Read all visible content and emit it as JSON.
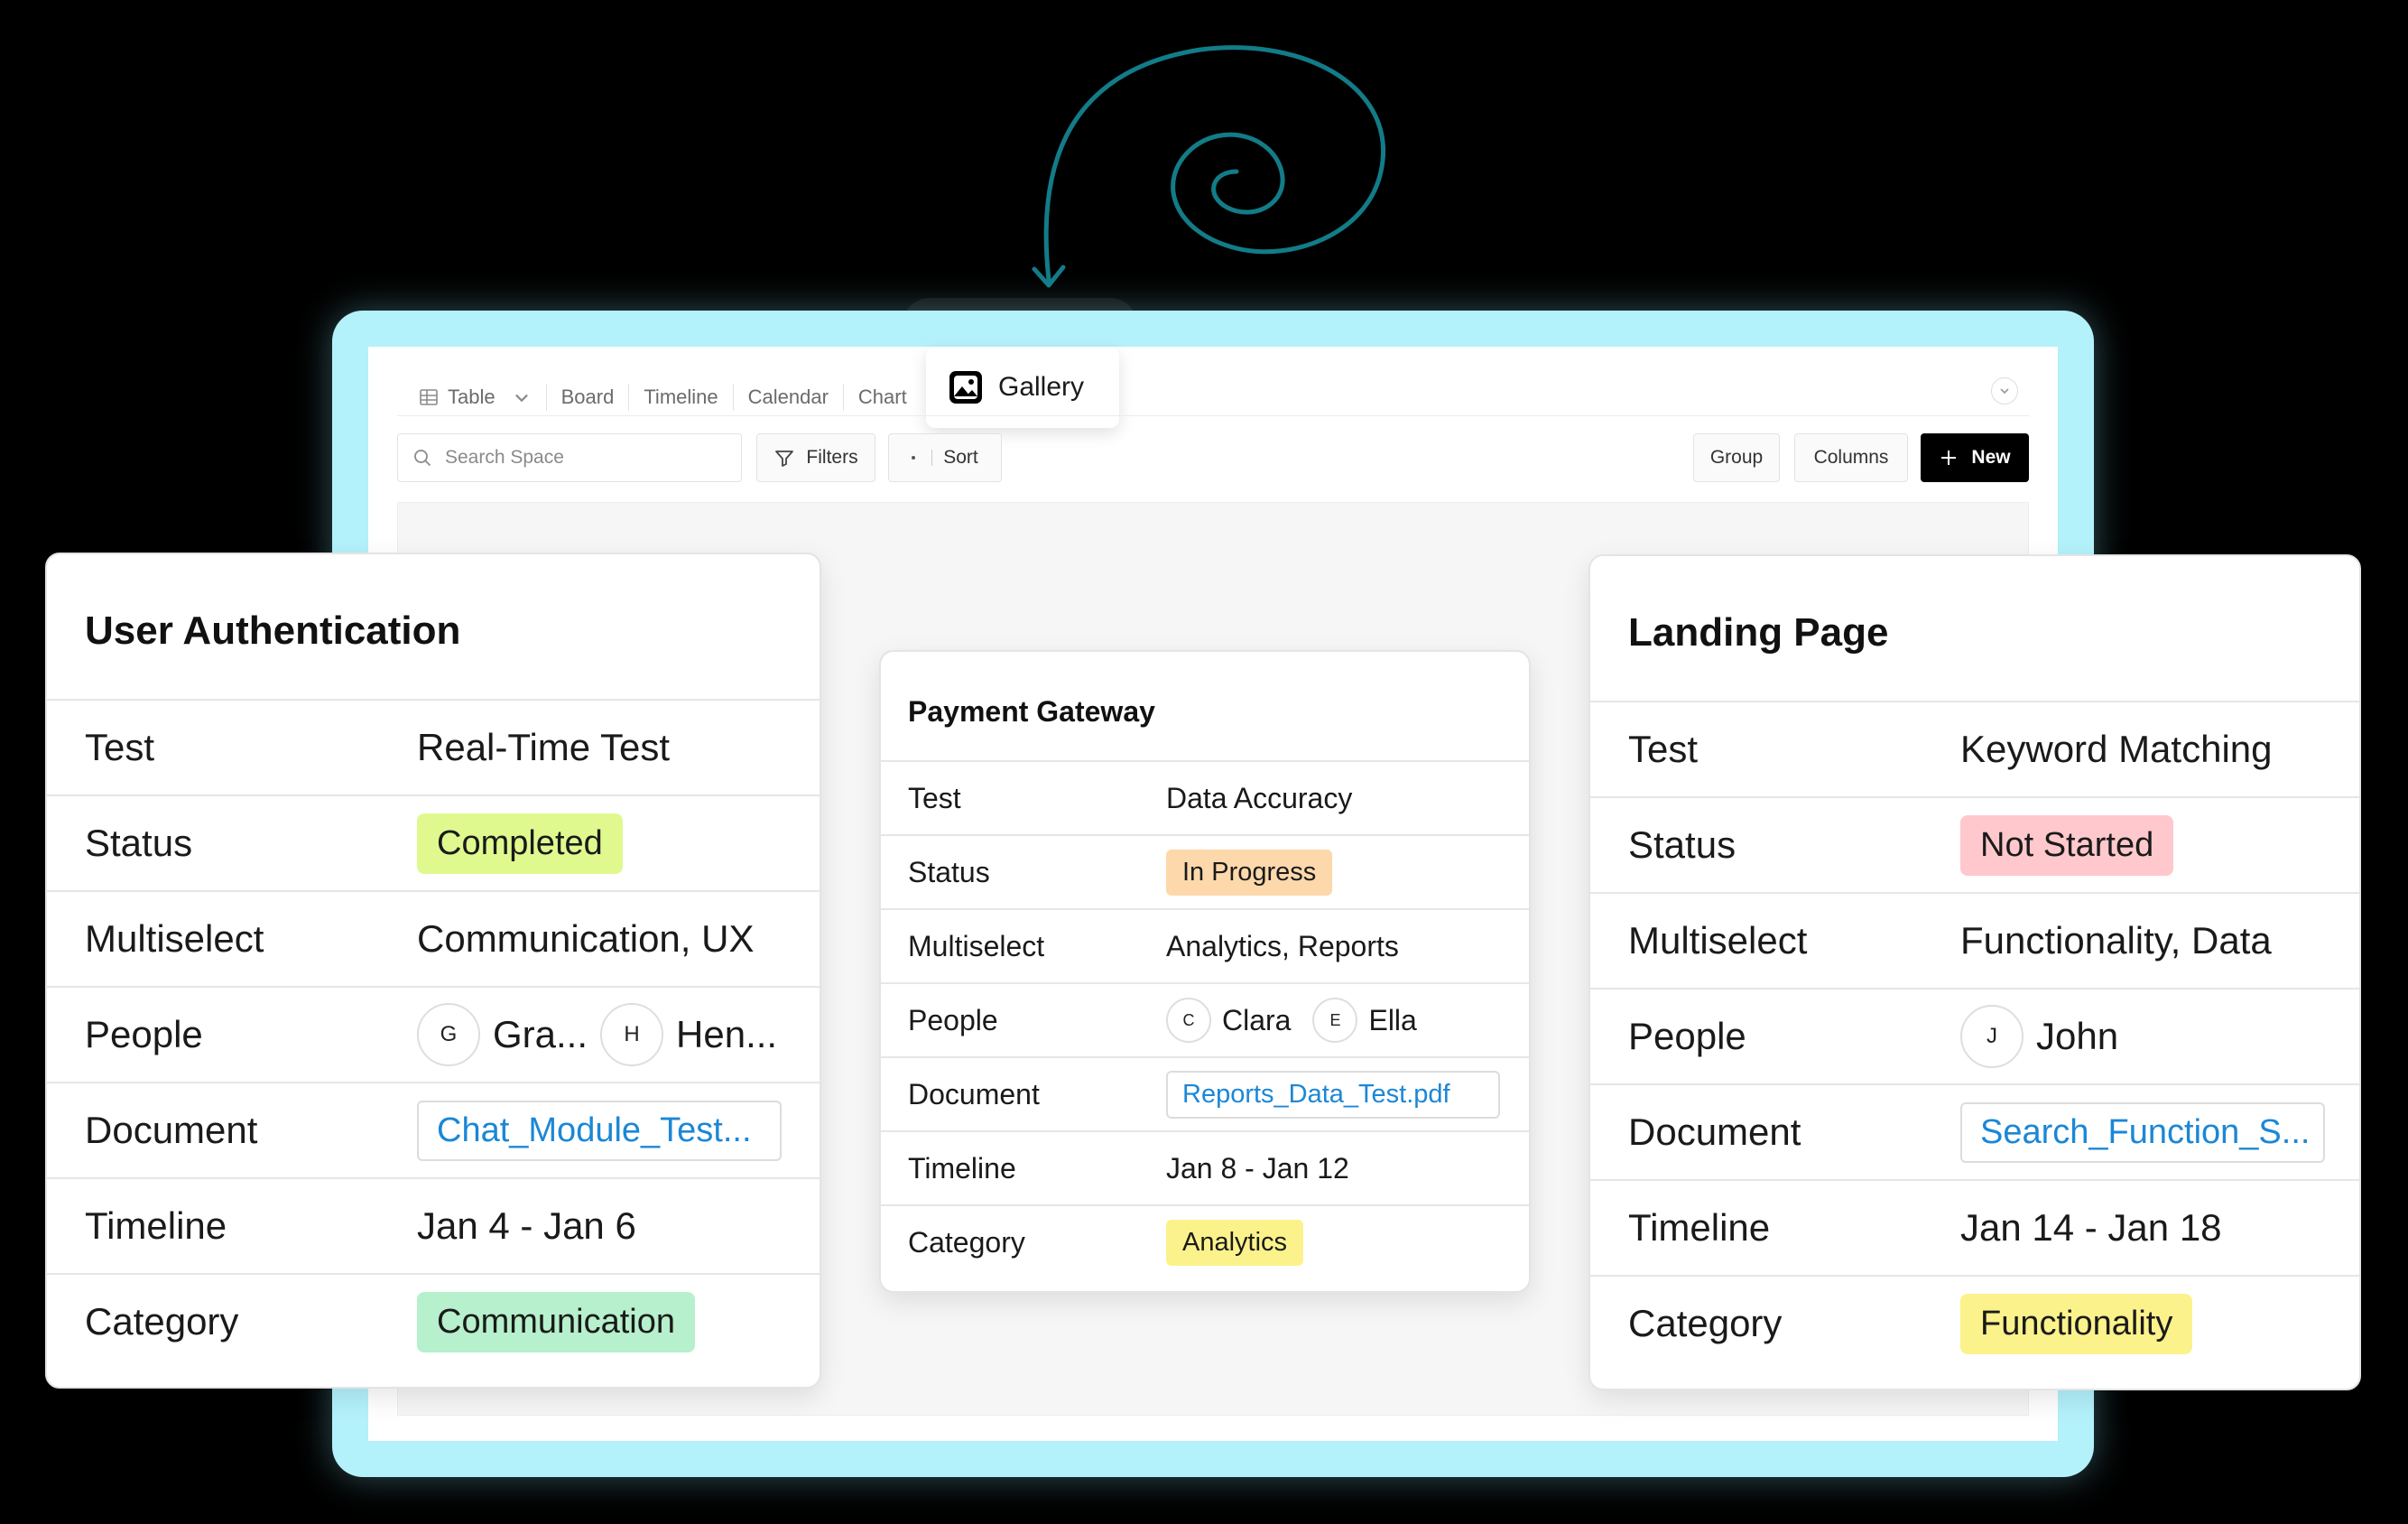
{
  "toolbar": {
    "views": [
      {
        "label": "Table",
        "icon": "table-icon"
      },
      {
        "label": "Board"
      },
      {
        "label": "Timeline"
      },
      {
        "label": "Calendar"
      },
      {
        "label": "Chart"
      }
    ],
    "active_view": {
      "label": "Gallery",
      "icon": "gallery-icon"
    },
    "search_placeholder": "Search Space",
    "filters_label": "Filters",
    "sort_label": "Sort",
    "group_label": "Group",
    "columns_label": "Columns",
    "new_label": "New"
  },
  "cards": {
    "left": {
      "title": "User Authentication",
      "test_label": "Test",
      "test": "Real-Time Test",
      "status_label": "Status",
      "status": "Completed",
      "multiselect_label": "Multiselect",
      "multiselect": "Communication, UX",
      "people_label": "People",
      "people": [
        {
          "initial": "G",
          "name": "Gra..."
        },
        {
          "initial": "H",
          "name": "Hen..."
        }
      ],
      "document_label": "Document",
      "document": "Chat_Module_Test...",
      "timeline_label": "Timeline",
      "timeline": "Jan 4 - Jan 6",
      "category_label": "Category",
      "category": "Communication"
    },
    "middle": {
      "title": "Payment Gateway",
      "test_label": "Test",
      "test": "Data Accuracy",
      "status_label": "Status",
      "status": "In Progress",
      "multiselect_label": "Multiselect",
      "multiselect": "Analytics, Reports",
      "people_label": "People",
      "people": [
        {
          "initial": "C",
          "name": "Clara"
        },
        {
          "initial": "E",
          "name": "Ella"
        }
      ],
      "document_label": "Document",
      "document": "Reports_Data_Test.pdf",
      "timeline_label": "Timeline",
      "timeline": "Jan 8 - Jan 12",
      "category_label": "Category",
      "category": "Analytics"
    },
    "right": {
      "title": "Landing Page",
      "test_label": "Test",
      "test": "Keyword Matching",
      "status_label": "Status",
      "status": "Not Started",
      "multiselect_label": "Multiselect",
      "multiselect": "Functionality, Data",
      "people_label": "People",
      "people": [
        {
          "initial": "J",
          "name": "John"
        }
      ],
      "document_label": "Document",
      "document": "Search_Function_S...",
      "timeline_label": "Timeline",
      "timeline": "Jan 14 - Jan 18",
      "category_label": "Category",
      "category": "Functionality"
    }
  },
  "colors": {
    "frame": "#b3f1fb",
    "spiral": "#127c88",
    "link": "#1b87d6",
    "status_completed": "#dff98f",
    "status_in_progress": "#fcd8ab",
    "status_not_started": "#fec8cc",
    "category_communication": "#b6f0cc",
    "category_analytics": "#fbf28b",
    "category_functionality": "#fbf28b"
  }
}
